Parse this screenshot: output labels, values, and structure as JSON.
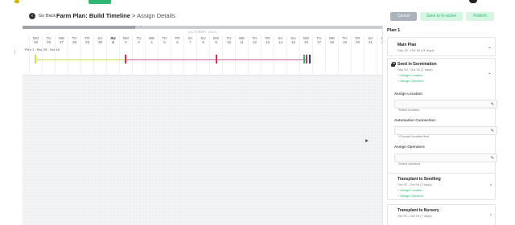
{
  "header": {
    "back_label": "Go Back",
    "title_main": "Farm Plan: Build Timeline",
    "title_sep": " > ",
    "title_sub": "Assign Details",
    "cancel_label": "Cancel",
    "save_label": "Save to In-active",
    "publish_label": "Publish"
  },
  "timeline": {
    "month_label": "OCTOBER, 2023",
    "plan_label": "Plan 1 : Sep 25 - Oct 18",
    "days": [
      {
        "dw": "MO",
        "dn": "25"
      },
      {
        "dw": "TU",
        "dn": "26"
      },
      {
        "dw": "WE",
        "dn": "27"
      },
      {
        "dw": "TH",
        "dn": "28"
      },
      {
        "dw": "FR",
        "dn": "29"
      },
      {
        "dw": "SA",
        "dn": "30"
      },
      {
        "dw": "SU",
        "dn": "1"
      },
      {
        "dw": "MO",
        "dn": "2"
      },
      {
        "dw": "TU",
        "dn": "3"
      },
      {
        "dw": "WE",
        "dn": "4"
      },
      {
        "dw": "TH",
        "dn": "5"
      },
      {
        "dw": "FR",
        "dn": "6"
      },
      {
        "dw": "SA",
        "dn": "7"
      },
      {
        "dw": "SU",
        "dn": "8"
      },
      {
        "dw": "MO",
        "dn": "9"
      },
      {
        "dw": "TU",
        "dn": "10"
      },
      {
        "dw": "WE",
        "dn": "11"
      },
      {
        "dw": "TH",
        "dn": "12"
      },
      {
        "dw": "FR",
        "dn": "13"
      },
      {
        "dw": "SA",
        "dn": "14"
      },
      {
        "dw": "SU",
        "dn": "15"
      },
      {
        "dw": "MO",
        "dn": "16"
      },
      {
        "dw": "TU",
        "dn": "17"
      },
      {
        "dw": "WE",
        "dn": "18"
      },
      {
        "dw": "TH",
        "dn": "19"
      },
      {
        "dw": "FR",
        "dn": "20"
      },
      {
        "dw": "SA",
        "dn": "21"
      },
      {
        "dw": "SU",
        "dn": "22"
      }
    ],
    "colors": {
      "seed": "#d6e04a",
      "transplant": "#d6679e",
      "nursery": "#2eb872",
      "red": "#d6334f",
      "blue": "#2f3c8f"
    }
  },
  "panel": {
    "title": "Plan 1",
    "main_plan": {
      "name": "Main Plan",
      "dates": "Sep 25 - Oct 18 (21 days)"
    },
    "seed": {
      "name": "Seed in Germination",
      "dates": "Sep 25 - Oct 02 (7 days)",
      "assign_location": "+ Assign Location",
      "assign_operator": "+ Assign Operator"
    },
    "location_label": "Assign Location",
    "location_placeholder": "Select location",
    "automation_label": "Automation Connection",
    "automation_placeholder": "*Choose location first",
    "operators_label": "Assign Operators",
    "operators_placeholder": "Select operator",
    "transplant_seedling": {
      "name": "Transplant to Seedling",
      "dates": "Oct 02 - Oct 09 (7 days)",
      "assign_location": "+ Assign Location",
      "assign_operator": "+ Assign Operator"
    },
    "transplant_nursery": {
      "name": "Transplant to Nursery",
      "dates": "Oct 09 - Oct 16 (7 days)"
    }
  }
}
